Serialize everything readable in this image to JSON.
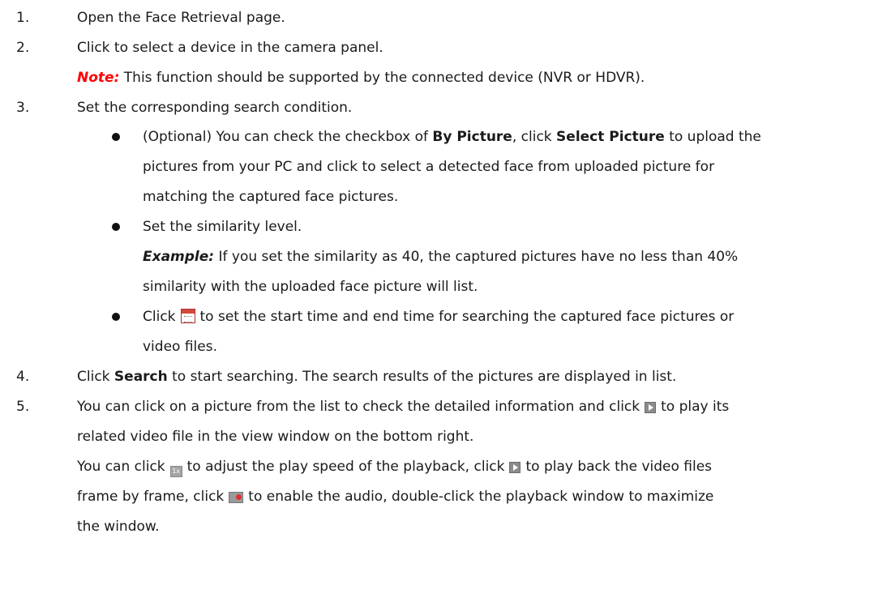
{
  "steps": {
    "s1": {
      "num": "1.",
      "text": "Open the Face Retrieval page."
    },
    "s2": {
      "num": "2.",
      "text": "Click to select a device in the camera panel.",
      "note_label": "Note:",
      "note_text": " This function should be supported by the connected device (NVR or HDVR)."
    },
    "s3": {
      "num": "3.",
      "text": "Set the corresponding search condition.",
      "b1": {
        "pre": "(Optional) You can check the checkbox of ",
        "bold1": "By Picture",
        "mid": ", click ",
        "bold2": "Select Picture",
        "post": " to upload the",
        "l2": "pictures from your PC and click to select a detected face from uploaded picture for",
        "l3": "matching the captured face pictures."
      },
      "b2": {
        "text": "Set the similarity level.",
        "ex_label": "Example:",
        "ex_text": " If you set the similarity as 40, the captured pictures have no less than 40%",
        "l3": "similarity with the uploaded face picture will list."
      },
      "b3": {
        "pre": "Click",
        "post": "to set the start time and end time for searching the captured face pictures or",
        "l2": "video files."
      }
    },
    "s4": {
      "num": "4.",
      "pre": "Click ",
      "bold": "Search",
      "post": " to start searching. The search results of the pictures are displayed in list."
    },
    "s5": {
      "num": "5.",
      "l1_pre": "You can click on a picture from the list to check the detailed information and click",
      "l1_post": "to play its",
      "l2": "related video file in the view window on the bottom right.",
      "l3_a": "You can click",
      "l3_b": "to adjust the play speed of the playback, click",
      "l3_c": "to play back the video files",
      "l4_a": "frame by frame, click",
      "l4_b": "to enable the audio, double-click the playback window to maximize",
      "l5": "the window."
    }
  },
  "icons": {
    "calendar": "calendar-icon",
    "play": "play-icon",
    "speed": "speed-1x-icon",
    "frame": "frame-play-icon",
    "audio": "audio-icon",
    "speed_label": "1x"
  },
  "colors": {
    "note": "#ff0000",
    "bullet": "#111111"
  }
}
